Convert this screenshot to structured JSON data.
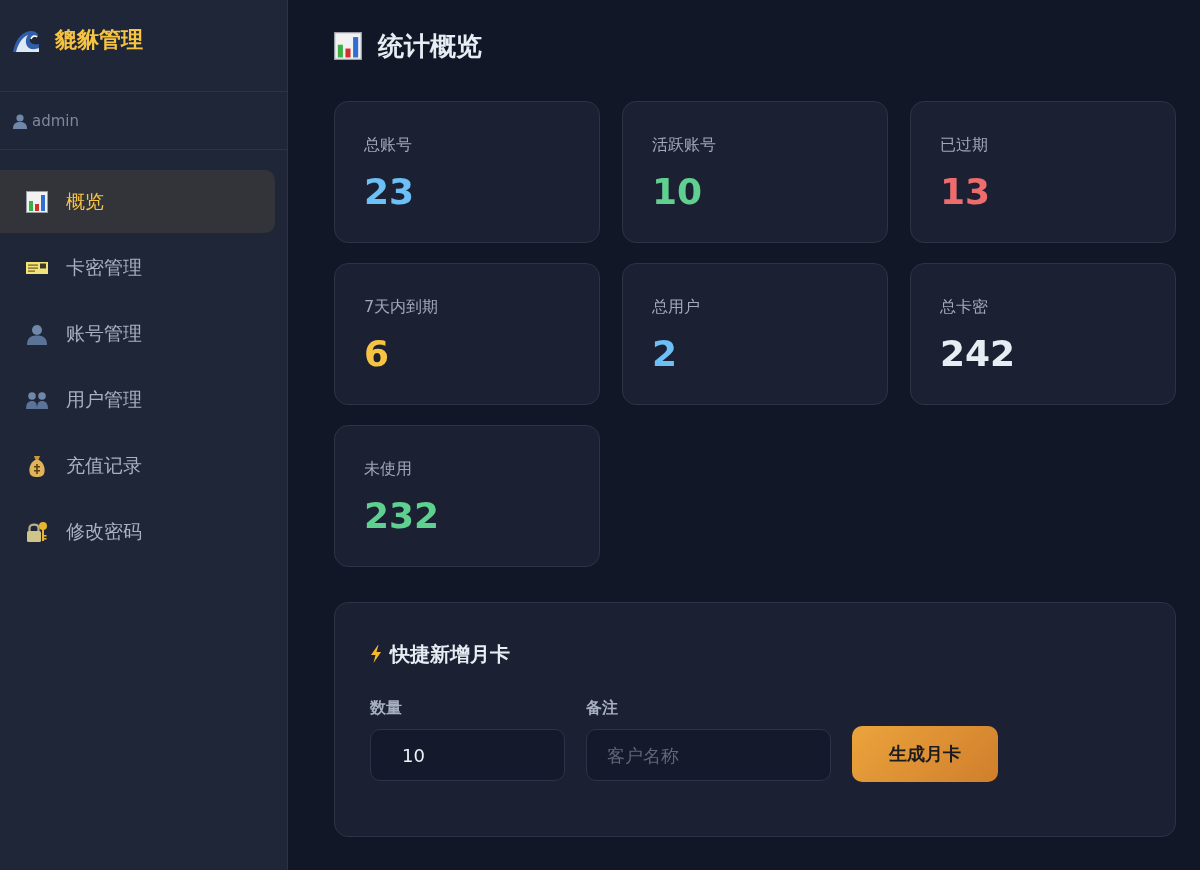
{
  "sidebar": {
    "logo": {
      "title": "貔貅管理"
    },
    "user": {
      "name": "admin"
    },
    "nav": [
      {
        "label": "概览",
        "selected": true
      },
      {
        "label": "卡密管理",
        "selected": false
      },
      {
        "label": "账号管理",
        "selected": false
      },
      {
        "label": "用户管理",
        "selected": false
      },
      {
        "label": "充值记录",
        "selected": false
      },
      {
        "label": "修改密码",
        "selected": false
      }
    ]
  },
  "main": {
    "title": "统计概览",
    "stats": [
      {
        "label": "总账号",
        "value": "23",
        "color": "#6cc0f5"
      },
      {
        "label": "活跃账号",
        "value": "10",
        "color": "#5fd08f"
      },
      {
        "label": "已过期",
        "value": "13",
        "color": "#ee6c6c"
      },
      {
        "label": "7天内到期",
        "value": "6",
        "color": "#f6c343"
      },
      {
        "label": "总用户",
        "value": "2",
        "color": "#6cc0f5"
      },
      {
        "label": "总卡密",
        "value": "242",
        "color": "#e8ecf3"
      },
      {
        "label": "未使用",
        "value": "232",
        "color": "#5fd08f"
      }
    ],
    "quick_add": {
      "title": "快捷新增月卡",
      "fields": [
        {
          "label": "数量",
          "value": "10"
        },
        {
          "label": "备注",
          "placeholder": "客户名称"
        }
      ],
      "button": "生成月卡"
    }
  }
}
